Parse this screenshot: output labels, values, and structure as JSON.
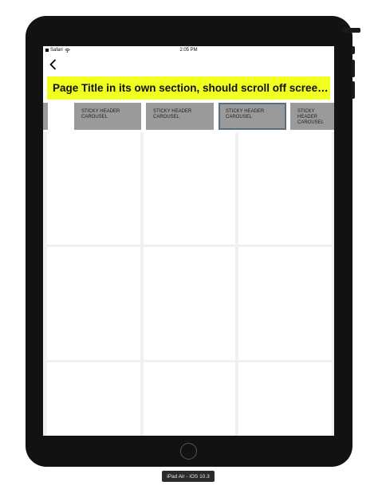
{
  "status_bar": {
    "carrier": "Safari",
    "time": "2:05 PM"
  },
  "nav": {
    "back_icon": "chevron-left-icon"
  },
  "page_title": "Page Title in its own section, should scroll off screen...",
  "carousel": {
    "items": [
      {
        "label": ""
      },
      {
        "label": "STICKY HEADER CAROUSEL"
      },
      {
        "label": "STICKY HEADER CAROUSEL"
      },
      {
        "label": "STICKY HEADER CAROUSEL",
        "selected": true
      },
      {
        "label": "STICKY HEADER CAROUSEL"
      }
    ]
  },
  "device_caption": "iPad Air - iOS 10.3",
  "colors": {
    "title_band": "#f0ff1e",
    "chip": "#9a9a9a",
    "chip_selected_border": "#5a6f7d",
    "grid_gap": "#f2f0ec",
    "bezel": "#121212"
  }
}
